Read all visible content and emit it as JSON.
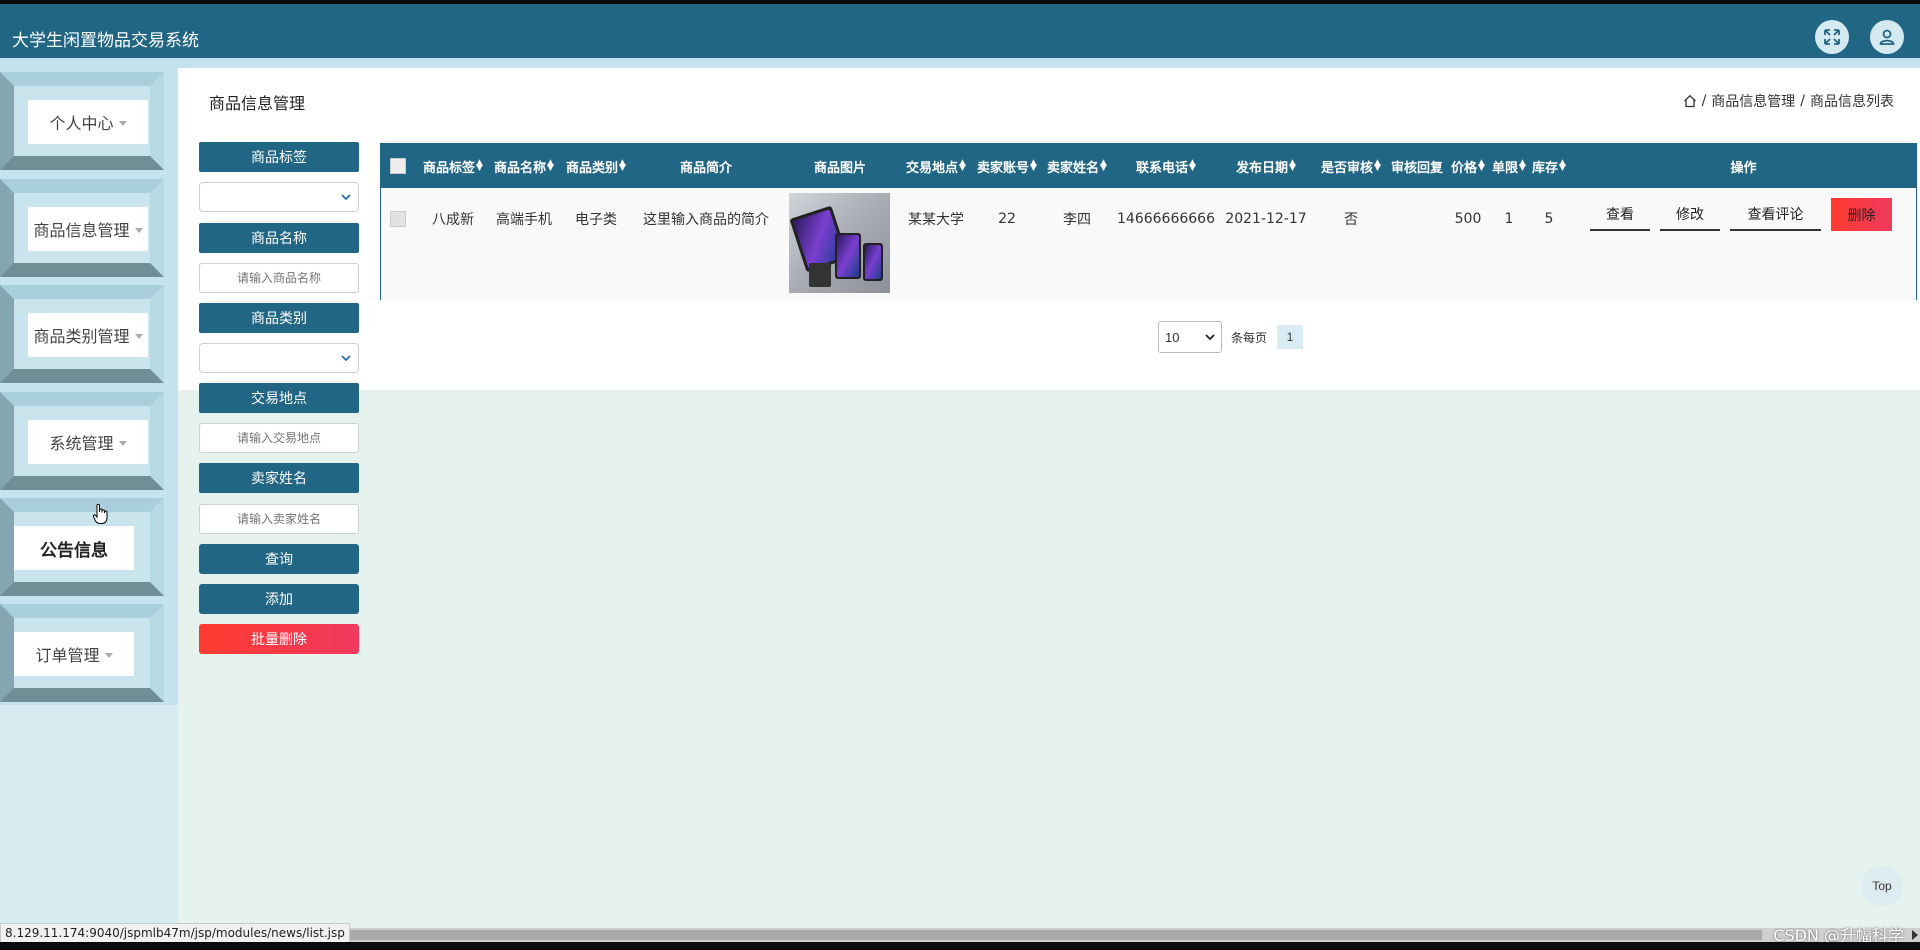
{
  "app": {
    "title": "大学生闲置物品交易系统"
  },
  "header": {
    "fullscreen_icon": "fullscreen-icon",
    "user_icon": "user-icon"
  },
  "sidebar": {
    "items": [
      {
        "label": "个人中心",
        "has_caret": true
      },
      {
        "label": "商品信息管理",
        "has_caret": true
      },
      {
        "label": "商品类别管理",
        "has_caret": true
      },
      {
        "label": "系统管理",
        "has_caret": true
      },
      {
        "label": "公告信息",
        "has_caret": false,
        "active": true
      },
      {
        "label": "订单管理",
        "has_caret": true
      }
    ]
  },
  "page": {
    "title": "商品信息管理",
    "breadcrumb": [
      "商品信息管理",
      "商品信息列表"
    ],
    "breadcrumb_sep": "/"
  },
  "search": {
    "tag_label": "商品标签",
    "name_label": "商品名称",
    "name_placeholder": "请输入商品名称",
    "category_label": "商品类别",
    "location_label": "交易地点",
    "location_placeholder": "请输入交易地点",
    "seller_label": "卖家姓名",
    "seller_placeholder": "请输入卖家姓名",
    "query_button": "查询",
    "add_button": "添加",
    "batch_delete_button": "批量删除"
  },
  "table": {
    "columns": [
      "商品标签",
      "商品名称",
      "商品类别",
      "商品简介",
      "商品图片",
      "交易地点",
      "卖家账号",
      "卖家姓名",
      "联系电话",
      "发布日期",
      "是否审核",
      "审核回复",
      "价格",
      "单限",
      "库存",
      "操作"
    ],
    "rows": [
      {
        "tag": "八成新",
        "name": "高端手机",
        "category": "电子类",
        "intro": "这里输入商品的简介",
        "location": "某某大学",
        "seller_account": "22",
        "seller_name": "李四",
        "phone": "14666666666",
        "date": "2021-12-17",
        "audited": "否",
        "audit_reply": "",
        "price": "500",
        "limit": "1",
        "stock": "5"
      }
    ],
    "actions": {
      "view": "查看",
      "edit": "修改",
      "comments": "查看评论",
      "delete": "删除"
    }
  },
  "pager": {
    "page_size": "10",
    "per_page_text": "条每页",
    "current_page": "1"
  },
  "top_button": "Top",
  "status_url": "8.129.11.174:9040/jspmlb47m/jsp/modules/news/list.jsp",
  "watermark": "CSDN @升幅科学",
  "colors": {
    "primary": "#226685",
    "danger": "#ff3b30",
    "sidebar": "#c4e3ee",
    "background": "#e6f2ee"
  }
}
